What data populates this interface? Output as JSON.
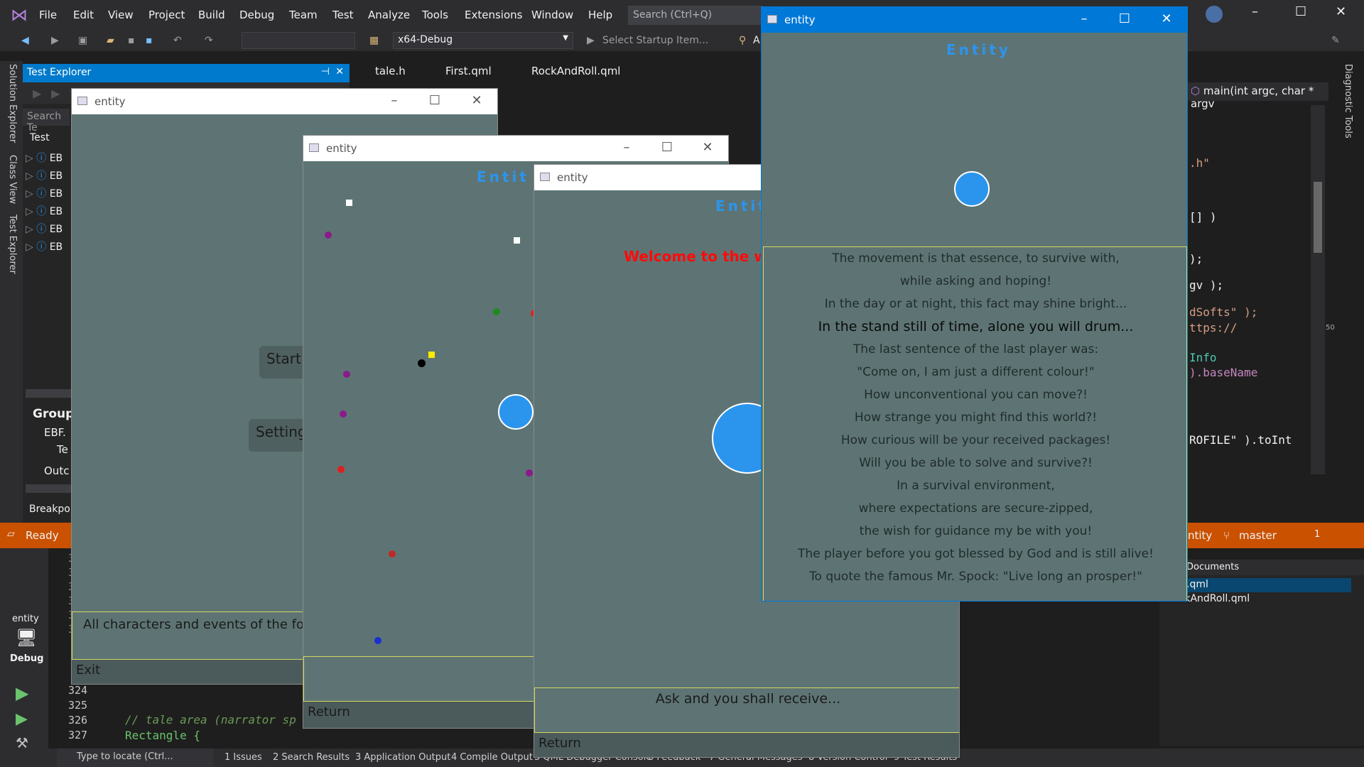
{
  "ide": {
    "menu": [
      "File",
      "Edit",
      "View",
      "Project",
      "Build",
      "Debug",
      "Team",
      "Test",
      "Analyze",
      "Tools",
      "Extensions",
      "Window",
      "Help"
    ],
    "search_placeholder": "Search (Ctrl+Q)",
    "config": "x64-Debug",
    "startup": "Select Startup Item...",
    "startup_suffix": "A",
    "test_explorer": "Test Explorer",
    "search_tests": "Search Te",
    "test_col": "Test",
    "test_items": [
      "EB",
      "EB",
      "EB",
      "EB",
      "EB",
      "EB"
    ],
    "group_label": "Group",
    "group_rows": [
      "EBF.",
      "Te",
      "Outc"
    ],
    "breakpoints": "Breakpoi",
    "side_tabs": [
      "Solution Explorer",
      "Class View",
      "Test Explorer"
    ],
    "right_tab": "Diagnostic Tools",
    "doc_tabs": [
      "tale.h",
      "First.qml",
      "RockAndRoll.qml"
    ],
    "func_dropdown": "main(int argc, char * argv",
    "code_lines": [
      ".h\"",
      "[] )",
      ");",
      "gv );",
      "dSofts\" );",
      "ttps://",
      "Info",
      ").baseName",
      "ROFILE\" ).toInt"
    ],
    "status": "Ready",
    "status_branch_prefix": "ntity",
    "status_branch": "master",
    "status_badge": "1",
    "documents_header": "Documents",
    "documents": [
      ".qml",
      "RockAndRoll.qml"
    ],
    "margin_num": "50",
    "debug_target": "entity",
    "debug_mode": "Debug",
    "line_numbers": [
      "3",
      "3",
      "3",
      "3",
      "3",
      "3",
      "324",
      "325",
      "326",
      "327"
    ],
    "code_bottom": [
      "// tale area (narrator sp",
      "Rectangle {"
    ],
    "bottom_locate": "Type to locate (Ctrl...",
    "bottom_tabs": [
      "1  Issues",
      "2  Search Results",
      "3  Application Output",
      "4  Compile Output",
      "5  QML Debugger Console",
      "6  Feedback",
      "7  General Messages",
      "8  Version Control",
      "9  Test Results"
    ],
    "colors": {
      "accent": "#007acc",
      "status": "#ca5100",
      "app_bg": "#5e7474",
      "entity_blue": "#2b95ee"
    }
  },
  "windows": {
    "w1": {
      "title": "entity",
      "start": "Start",
      "settings": "Setting",
      "tale": "All characters and events of the follo",
      "exit": "Exit"
    },
    "w2": {
      "title": "entity",
      "heading": "Entit",
      "return": "Return"
    },
    "w3": {
      "title": "entity",
      "heading": "Entit",
      "welcome": "Welcome to the wo",
      "prompt": "Ask and you shall receive...",
      "return": "Return"
    },
    "w4": {
      "title": "entity",
      "heading": "Entity",
      "poem": [
        "The movement is that essence, to survive with,",
        "while asking and hoping!",
        "In the day or at night, this fact may shine bright...",
        "In the stand still of time, alone you will drum...",
        "The last sentence of the last player was:",
        "\"Come on, I am just a different colour!\"",
        "How unconventional you can move?!",
        "How strange you might find this world?!",
        "How curious will be your received packages!",
        "Will you be able to solve and survive?!",
        "In a survival environment,",
        "where expectations are secure-zipped,",
        "the wish for guidance my be with you!",
        "The player before you got blessed by God and is still alive!",
        "To quote the famous Mr. Spock: \"Live long an prosper!\""
      ]
    }
  }
}
